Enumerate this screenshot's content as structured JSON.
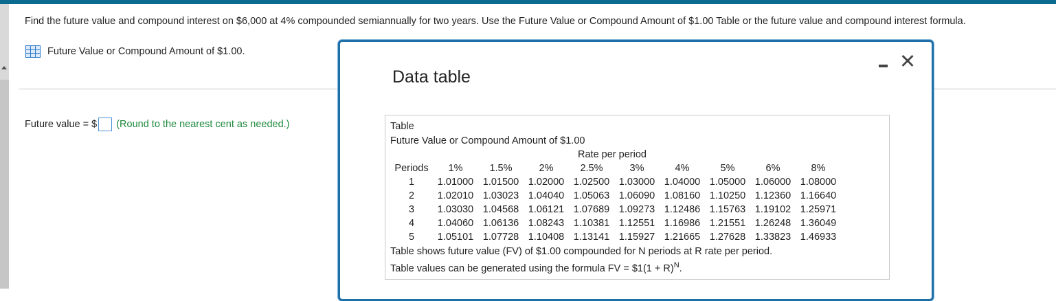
{
  "question": {
    "text": "Find the future value and compound interest on $6,000 at 4% compounded semiannually for two years. Use the Future Value or Compound Amount of $1.00 Table or the future value and compound interest formula.",
    "table_link": "Future Value or Compound Amount of $1.00."
  },
  "answer": {
    "label": "Future value = $",
    "hint": "(Round to the nearest cent as needed.)"
  },
  "modal": {
    "title": "Data table",
    "minimize_symbol": "—",
    "close_symbol": "✕",
    "table_label": "Table",
    "table_title": "Future Value or Compound Amount of $1.00",
    "rate_header": "Rate per period",
    "periods_header": "Periods",
    "rates": [
      "1%",
      "1.5%",
      "2%",
      "2.5%",
      "3%",
      "4%",
      "5%",
      "6%",
      "8%"
    ],
    "rows": [
      {
        "period": "1",
        "values": [
          "1.01000",
          "1.01500",
          "1.02000",
          "1.02500",
          "1.03000",
          "1.04000",
          "1.05000",
          "1.06000",
          "1.08000"
        ]
      },
      {
        "period": "2",
        "values": [
          "1.02010",
          "1.03023",
          "1.04040",
          "1.05063",
          "1.06090",
          "1.08160",
          "1.10250",
          "1.12360",
          "1.16640"
        ]
      },
      {
        "period": "3",
        "values": [
          "1.03030",
          "1.04568",
          "1.06121",
          "1.07689",
          "1.09273",
          "1.12486",
          "1.15763",
          "1.19102",
          "1.25971"
        ]
      },
      {
        "period": "4",
        "values": [
          "1.04060",
          "1.06136",
          "1.08243",
          "1.10381",
          "1.12551",
          "1.16986",
          "1.21551",
          "1.26248",
          "1.36049"
        ]
      },
      {
        "period": "5",
        "values": [
          "1.05101",
          "1.07728",
          "1.10408",
          "1.13141",
          "1.15927",
          "1.21665",
          "1.27628",
          "1.33823",
          "1.46933"
        ]
      }
    ],
    "footnote1": "Table shows future value (FV) of $1.00 compounded for N periods at R rate per period.",
    "footnote2_main": "Table values can be generated using the formula FV = $1(1 + R)",
    "footnote2_exp": "N",
    "footnote2_end": "."
  },
  "colors": {
    "accent": "#0b6a8f",
    "modal_border": "#1f6fa8",
    "hint_green": "#1e8a3c",
    "input_border": "#4a90d9"
  }
}
